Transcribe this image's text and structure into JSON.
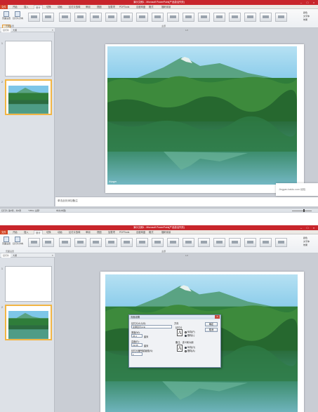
{
  "app": {
    "title": "演示文稿1 - Microsoft PowerPoint(产品激活失败)",
    "controls": [
      "–",
      "□",
      "×"
    ]
  },
  "tabs": [
    "文件",
    "开始",
    "插入",
    "设计",
    "切换",
    "动画",
    "幻灯片放映",
    "审阅",
    "视图",
    "加载项",
    "PDFTools",
    "百度网盘",
    "格式",
    "福昕阅读"
  ],
  "active_tab_index": 3,
  "ribbon": {
    "buttons": [
      {
        "label": "页面设置",
        "icon": "page-setup-icon"
      },
      {
        "label": "幻灯片方向",
        "icon": "slide-orientation-icon"
      }
    ],
    "group_labels": [
      "页面设置",
      "主题"
    ],
    "right": {
      "colors": "颜色",
      "fonts": "文字体",
      "effects": "效果"
    }
  },
  "panel": {
    "tab_slides": "幻灯片",
    "tab_outline": "大纲",
    "close": "×",
    "slides": [
      "1",
      "2"
    ]
  },
  "ruler_label": "1/2",
  "notes_placeholder": "单击此处添加备注",
  "status": {
    "slide_info": "幻灯片 第2张，共2张",
    "theme": "\"Office 主题\"",
    "language": "中文(中国)"
  },
  "watermark": "Wanger",
  "popup_text": "Jingyan.baidu.com 经验",
  "dialog": {
    "title": "页面设置",
    "size_label": "幻灯片大小(S):",
    "size_value": "全屏显示(4:3)",
    "width_label": "宽度(W):",
    "width_value": "25.4",
    "width_unit": "厘米",
    "height_label": "高度(E):",
    "height_value": "19.05",
    "height_unit": "厘米",
    "number_label": "幻灯片编号起始值(N):",
    "number_value": "1",
    "orientation_label": "方向",
    "slides_label": "幻灯片",
    "portrait": "纵向(P)",
    "landscape": "横向(L)",
    "notes_label": "备注、讲义和大纲",
    "notes_portrait": "纵向(O)",
    "notes_landscape": "横向(A)",
    "ok": "确定",
    "cancel": "取消",
    "close": "×"
  },
  "colors": {
    "title_bar": "#c8252b",
    "file_tab": "#d24726",
    "sky": "#7ec6e8",
    "forest": "#2f7d3a",
    "water": "#4e9c86",
    "mountain": "#5aa383",
    "highlight": "#e79a33",
    "selection": "#f2b544"
  }
}
